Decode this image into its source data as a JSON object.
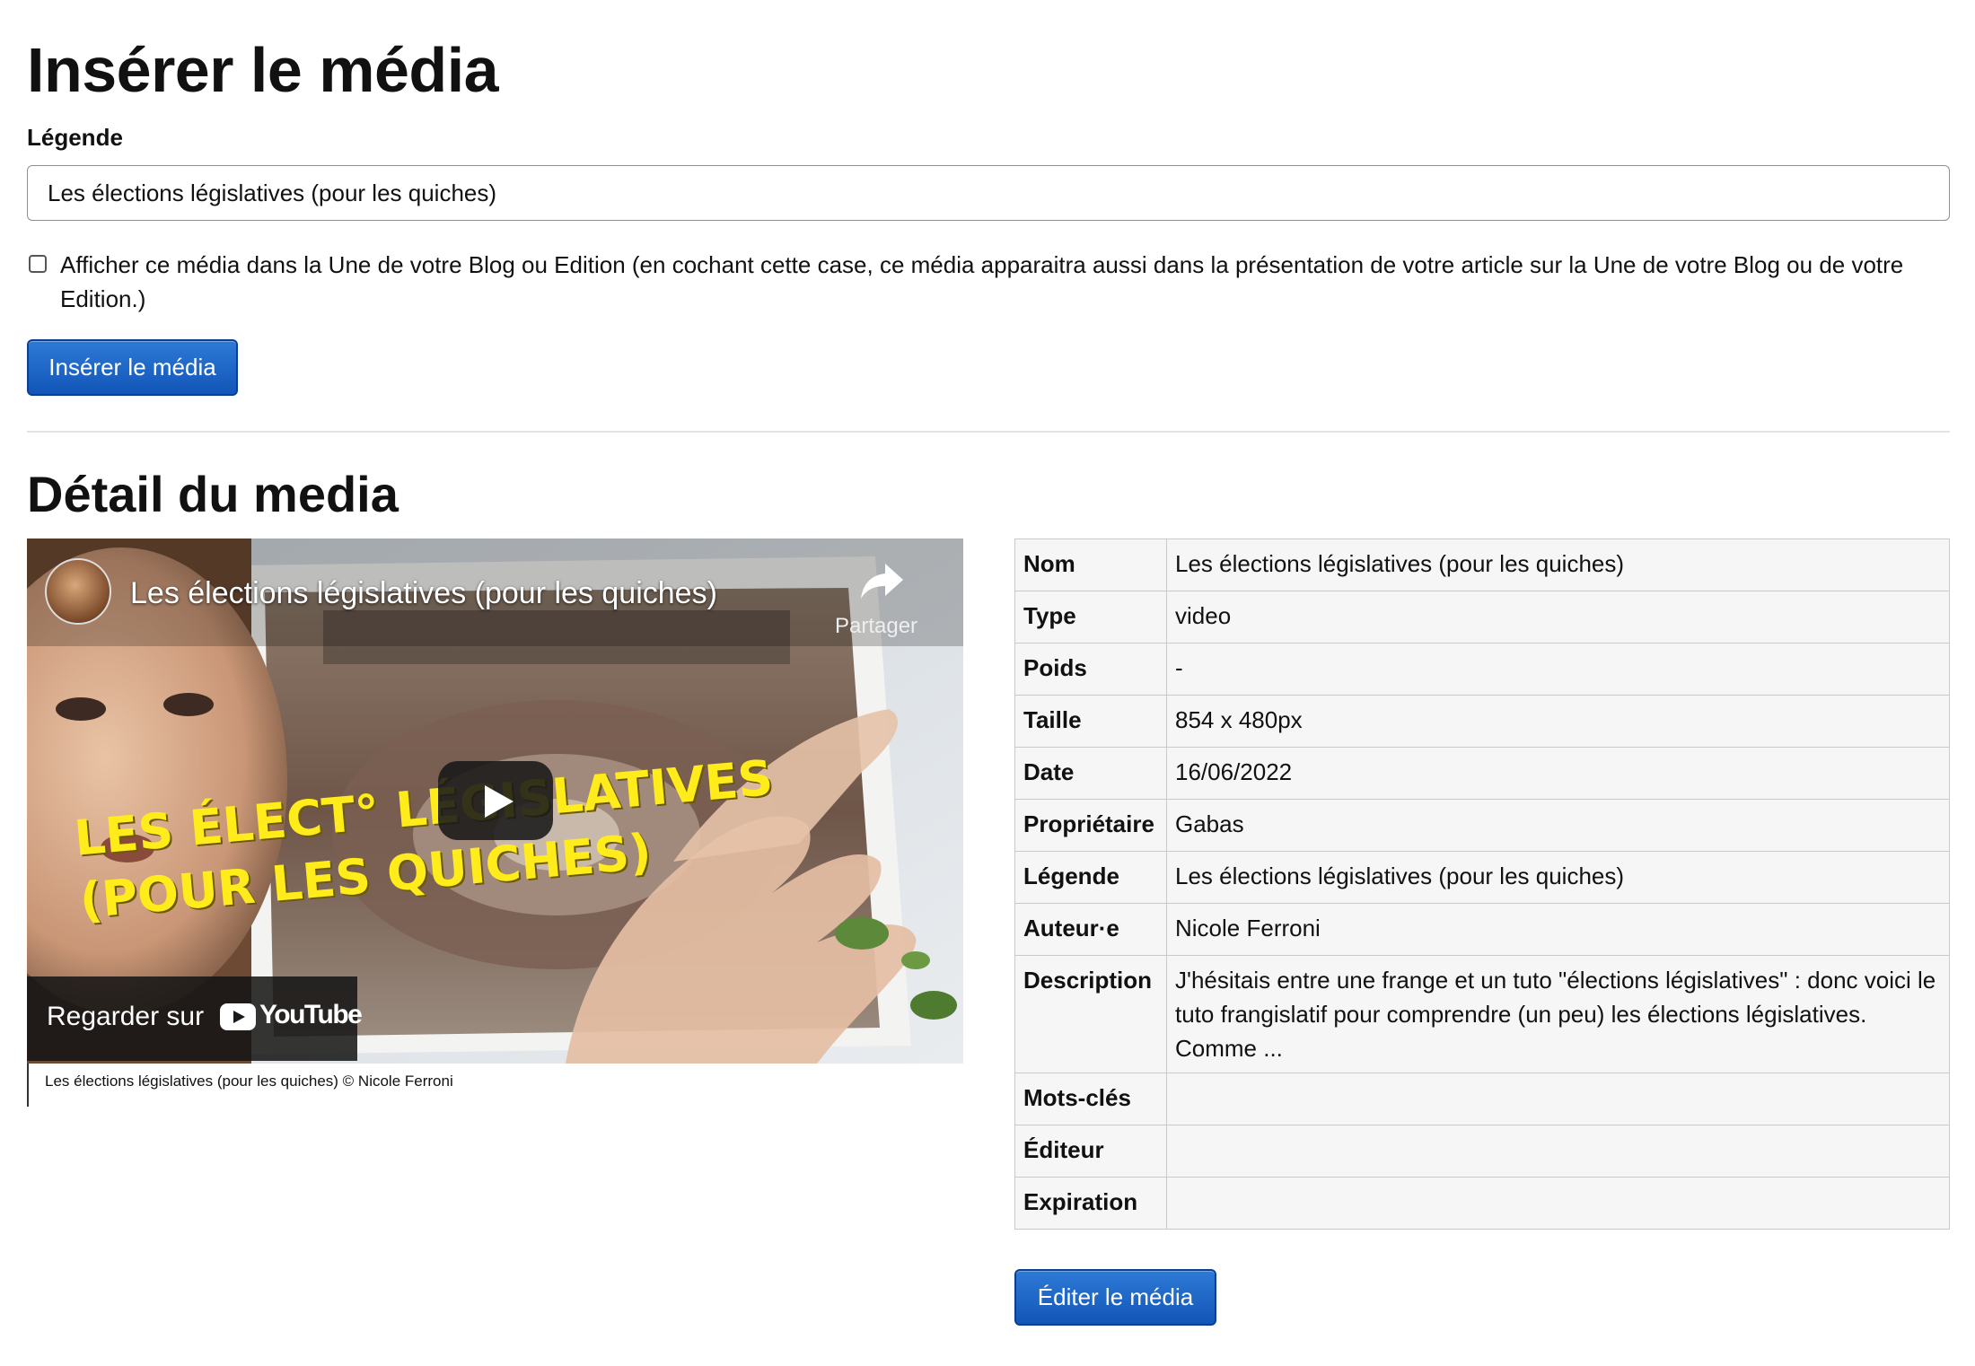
{
  "insert": {
    "title": "Insérer le média",
    "caption_label": "Légende",
    "caption_value": "Les élections législatives (pour les quiches)",
    "checkbox_label": "Afficher ce média dans la Une de votre Blog ou Edition (en cochant cette case, ce média apparaitra aussi dans la présentation de votre article sur la Une de votre Blog ou de votre Edition.)",
    "checkbox_checked": false,
    "button_label": "Insérer le média"
  },
  "detail": {
    "title": "Détail du media",
    "video": {
      "title": "Les élections législatives (pour les quiches)",
      "share_label": "Partager",
      "overlay_line1": "LES ÉLECT° LÉGISLATIVES",
      "overlay_line2": "(POUR LES QUICHES)",
      "watch_label": "Regarder sur",
      "logo_text": "YouTube",
      "caption": "Les élections législatives (pour les quiches) © Nicole Ferroni"
    },
    "table": [
      {
        "key": "Nom",
        "value": "Les élections législatives (pour les quiches)"
      },
      {
        "key": "Type",
        "value": "video"
      },
      {
        "key": "Poids",
        "value": "-"
      },
      {
        "key": "Taille",
        "value": "854 x 480px"
      },
      {
        "key": "Date",
        "value": "16/06/2022"
      },
      {
        "key": "Propriétaire",
        "value": "Gabas"
      },
      {
        "key": "Légende",
        "value": "Les élections législatives (pour les quiches)"
      },
      {
        "key": "Auteur·e",
        "value": "Nicole Ferroni"
      },
      {
        "key": "Description",
        "value": "J'hésitais entre une frange et un tuto \"élections législatives\" : donc voici le tuto frangislatif pour comprendre (un peu) les élections législatives. Comme ..."
      },
      {
        "key": "Mots-clés",
        "value": ""
      },
      {
        "key": "Éditeur",
        "value": ""
      },
      {
        "key": "Expiration",
        "value": ""
      }
    ],
    "edit_button_label": "Éditer le média"
  },
  "colors": {
    "button_blue": "#1a63c6",
    "overlay_yellow": "#ffec1a"
  }
}
